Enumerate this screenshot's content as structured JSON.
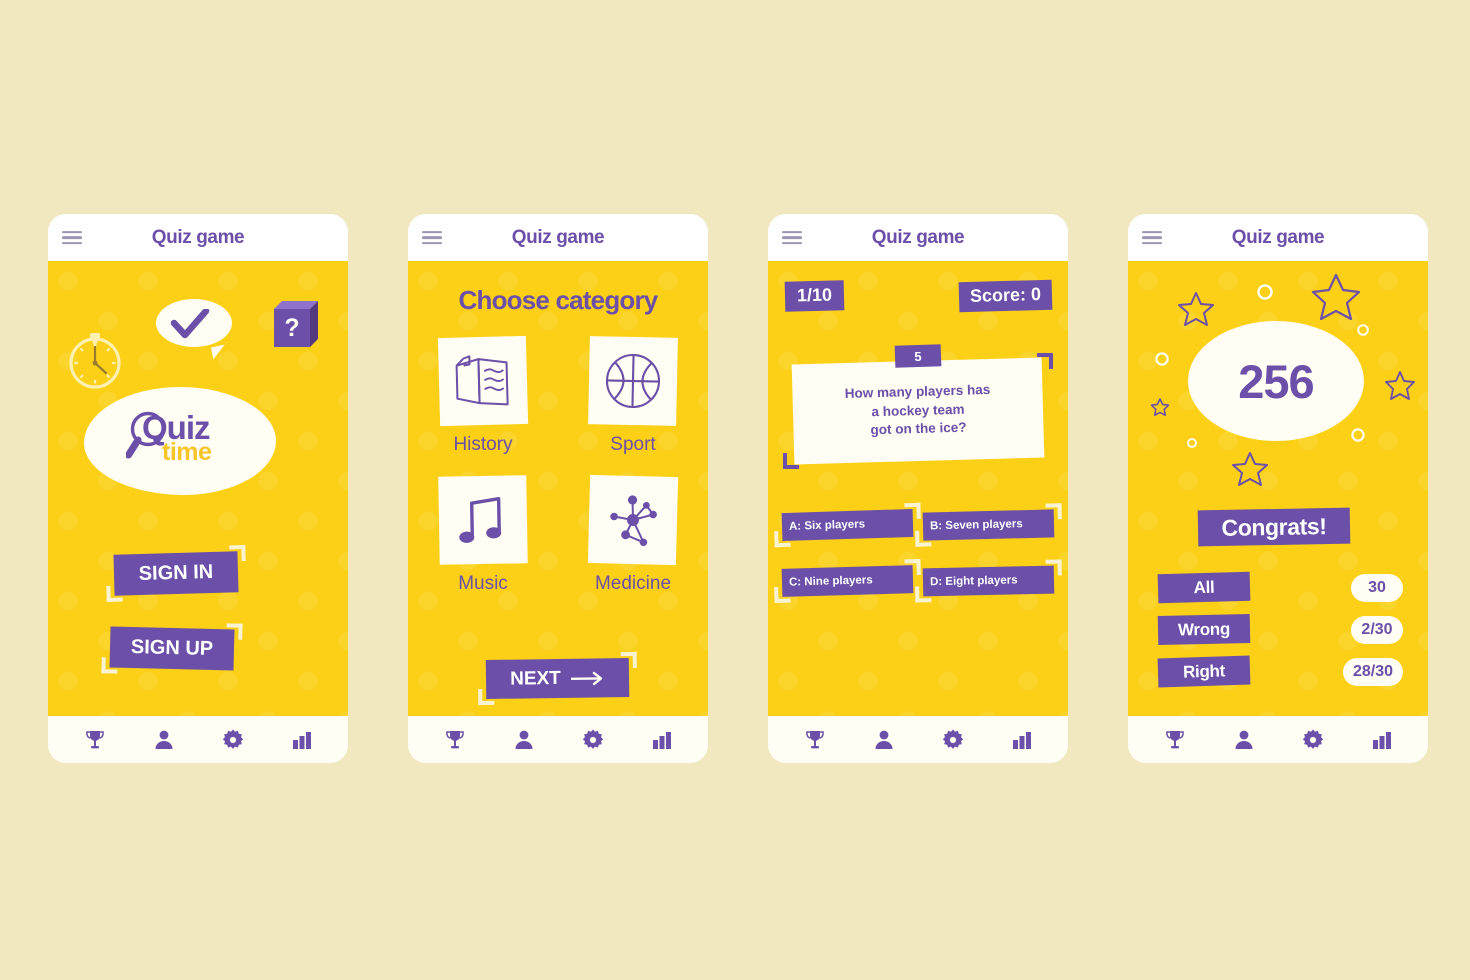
{
  "app": {
    "header_title": "Quiz game",
    "menu_icon": "hamburger-icon",
    "colors": {
      "page_background": "#f1e8c0",
      "screen_yellow": "#fbd017",
      "purple": "#6b4fa8",
      "cream_white": "#fffdf4",
      "gold": "#f6c52a"
    }
  },
  "nav": {
    "items": [
      {
        "icon": "trophy-icon",
        "name": "nav-trophy"
      },
      {
        "icon": "person-icon",
        "name": "nav-profile"
      },
      {
        "icon": "gear-icon",
        "name": "nav-settings"
      },
      {
        "icon": "bar-chart-icon",
        "name": "nav-stats"
      }
    ]
  },
  "screen_login": {
    "logo_primary": "Quiz",
    "logo_secondary": "time",
    "sign_in_label": "SIGN IN",
    "sign_up_label": "SIGN UP",
    "decorations": [
      "stopwatch-icon",
      "speech-bubble-check-icon",
      "question-cube-icon"
    ]
  },
  "screen_category": {
    "title": "Choose category",
    "categories": [
      {
        "label": "History",
        "icon": "open-book-icon"
      },
      {
        "label": "Sport",
        "icon": "basketball-icon"
      },
      {
        "label": "Music",
        "icon": "music-note-icon"
      },
      {
        "label": "Medicine",
        "icon": "molecule-icon"
      }
    ],
    "next_label": "NEXT",
    "next_icon": "arrow-right-icon"
  },
  "screen_question": {
    "progress": "1/10",
    "score": "Score: 0",
    "timer": "5",
    "question": "How many players has\na hockey team\ngot on the ice?",
    "answers": [
      "A:  Six players",
      "B:  Seven players",
      "C: Nine players",
      "D:  Eight players"
    ]
  },
  "screen_results": {
    "score": "256",
    "congrats": "Congrats!",
    "stats": [
      {
        "label": "All",
        "value": "30"
      },
      {
        "label": "Wrong",
        "value": "2/30"
      },
      {
        "label": "Right",
        "value": "28/30"
      }
    ],
    "decorations": [
      "star-outline",
      "circle-outline"
    ]
  }
}
